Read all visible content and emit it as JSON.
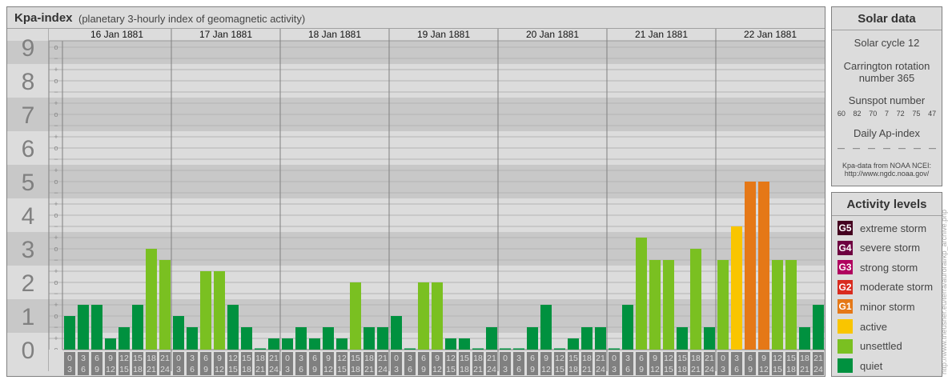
{
  "title": {
    "main": "Kpa-index",
    "sub": "(planetary 3-hourly index of geomagnetic activity)"
  },
  "chart_data": {
    "type": "bar",
    "title": "Kpa-index",
    "y_levels": [
      "0",
      "1",
      "2",
      "3",
      "4",
      "5",
      "6",
      "7",
      "8",
      "9"
    ],
    "sub_ticks": [
      "-",
      "o",
      "+"
    ],
    "ylim": [
      "0o",
      "9o"
    ],
    "days": [
      "16 Jan 1881",
      "17 Jan 1881",
      "18 Jan 1881",
      "19 Jan 1881",
      "20 Jan 1881",
      "21 Jan 1881",
      "22 Jan 1881"
    ],
    "hour_bins": [
      [
        "0",
        "3"
      ],
      [
        "3",
        "6"
      ],
      [
        "6",
        "9"
      ],
      [
        "9",
        "12"
      ],
      [
        "12",
        "15"
      ],
      [
        "15",
        "18"
      ],
      [
        "18",
        "21"
      ],
      [
        "21",
        "24"
      ]
    ],
    "values": [
      [
        "1o",
        "1+",
        "1+",
        "0+",
        "1-",
        "1+",
        "3o",
        "3-"
      ],
      [
        "1o",
        "1-",
        "2+",
        "2+",
        "1+",
        "1-",
        "0o",
        "0+"
      ],
      [
        "0+",
        "1-",
        "0+",
        "1-",
        "0+",
        "2o",
        "1-",
        "1-"
      ],
      [
        "1o",
        "0o",
        "2o",
        "2o",
        "0+",
        "0+",
        "0o",
        "1-"
      ],
      [
        "0o",
        "0o",
        "1-",
        "1+",
        "0o",
        "0+",
        "1-",
        "1-"
      ],
      [
        "0o",
        "1+",
        "3+",
        "3-",
        "3-",
        "1-",
        "3o",
        "1-"
      ],
      [
        "3-",
        "4-",
        "5o",
        "5o",
        "3-",
        "3-",
        "1-",
        "1+"
      ]
    ],
    "colors": {
      "quiet": "#00913f",
      "unsettled": "#7ac021",
      "active": "#f9c500",
      "G1": "#e57817",
      "G2": "#d92b1f",
      "G3": "#b0005e",
      "G4": "#6e0040",
      "G5": "#44001f"
    }
  },
  "solar": {
    "header": "Solar data",
    "cycle": "Solar cycle 12",
    "carrington1": "Carrington rotation",
    "carrington2": "number 365",
    "sunspot_label": "Sunspot number",
    "sunspots": [
      "60",
      "82",
      "70",
      "7",
      "72",
      "75",
      "47"
    ],
    "ap_label": "Daily Ap-index",
    "ap": [
      "—",
      "—",
      "—",
      "—",
      "—",
      "—",
      "—"
    ],
    "source1": "Kpa-data from NOAA NCEI:",
    "source2": "http://www.ngdc.noaa.gov/"
  },
  "activity": {
    "header": "Activity levels",
    "items": [
      {
        "badge": "G5",
        "label": "extreme storm",
        "color": "#44001f"
      },
      {
        "badge": "G4",
        "label": "severe storm",
        "color": "#6e0040"
      },
      {
        "badge": "G3",
        "label": "strong storm",
        "color": "#b0005e"
      },
      {
        "badge": "G2",
        "label": "moderate storm",
        "color": "#d92b1f"
      },
      {
        "badge": "G1",
        "label": "minor storm",
        "color": "#e57817"
      },
      {
        "badge": "",
        "label": "active",
        "color": "#f9c500"
      },
      {
        "badge": "",
        "label": "unsettled",
        "color": "#7ac021"
      },
      {
        "badge": "",
        "label": "quiet",
        "color": "#00913f"
      }
    ]
  },
  "credit": "http://www.theusner.eu/terra/auroral/kp_archive.php"
}
